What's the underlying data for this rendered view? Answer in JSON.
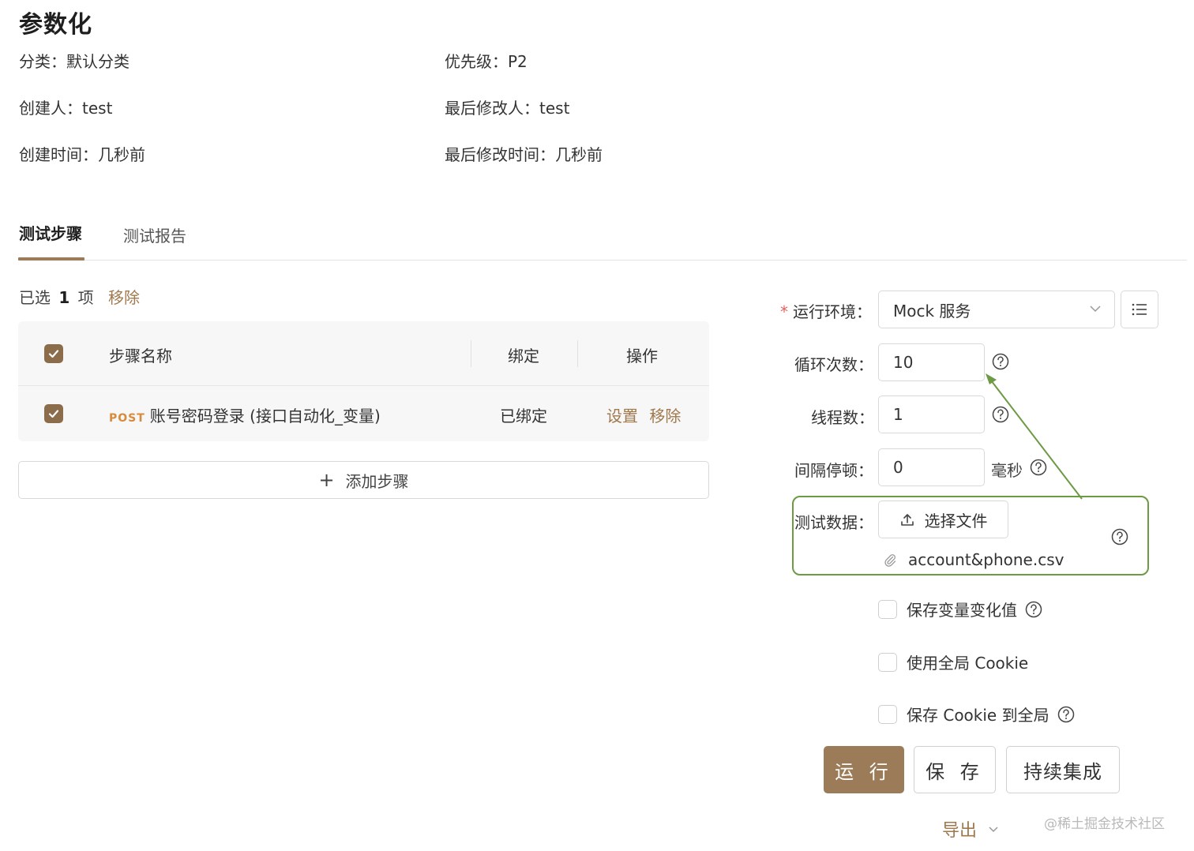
{
  "header": {
    "title": "参数化",
    "meta": {
      "category_label": "分类：",
      "category_value": "默认分类",
      "priority_label": "优先级：",
      "priority_value": "P2",
      "creator_label": "创建人：",
      "creator_value": "test",
      "modifier_label": "最后修改人：",
      "modifier_value": "test",
      "created_label": "创建时间：",
      "created_value": "几秒前",
      "modified_label": "最后修改时间：",
      "modified_value": "几秒前"
    }
  },
  "tabs": [
    {
      "label": "测试步骤",
      "active": true
    },
    {
      "label": "测试报告",
      "active": false
    }
  ],
  "selection": {
    "prefix": "已选",
    "count": "1",
    "suffix": "项",
    "remove_label": "移除"
  },
  "table": {
    "columns": [
      "步骤名称",
      "绑定",
      "操作"
    ],
    "rows": [
      {
        "checked": true,
        "method": "POST",
        "name": "账号密码登录 (接口自动化_变量)",
        "binding": "已绑定",
        "actions": [
          "设置",
          "移除"
        ]
      }
    ],
    "add_step_label": "添加步骤"
  },
  "form": {
    "env_label": "运行环境：",
    "env_value": "Mock 服务",
    "loop_label": "循环次数：",
    "loop_value": "10",
    "thread_label": "线程数：",
    "thread_value": "1",
    "interval_label": "间隔停顿：",
    "interval_value": "0",
    "interval_unit": "毫秒",
    "data_label": "测试数据：",
    "upload_label": "选择文件",
    "file_name": "account&phone.csv",
    "options": [
      {
        "label": "保存变量变化值",
        "checked": false,
        "help": true
      },
      {
        "label": "使用全局 Cookie",
        "checked": false,
        "help": false
      },
      {
        "label": "保存 Cookie 到全局",
        "checked": false,
        "help": true
      }
    ]
  },
  "actions": {
    "run_label": "运 行",
    "save_label": "保 存",
    "ci_label": "持续集成",
    "export_label": "导出"
  },
  "watermark": "@稀土掘金技术社区",
  "colors": {
    "accent": "#9b7b58",
    "link": "#a0784c",
    "annotation": "#6d9a45",
    "required": "#e26161",
    "post_method": "#d88a3d"
  }
}
